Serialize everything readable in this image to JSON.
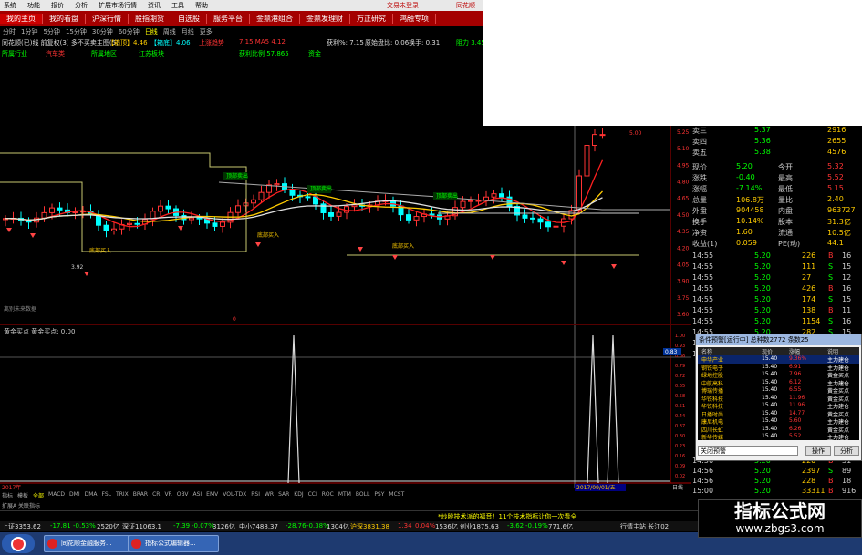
{
  "menu": {
    "items": [
      "系统",
      "功能",
      "报价",
      "分析",
      "扩展市场行情",
      "资讯",
      "工具",
      "帮助"
    ],
    "login": "交易未登录",
    "user": "同花顺"
  },
  "nav": {
    "items": [
      "我的主页",
      "我的看盘",
      "沪深行情",
      "股指期货",
      "自选股",
      "服务平台",
      "金鼎港组合",
      "金鼎发理财",
      "万正研究",
      "鸿融专项"
    ],
    "active": 0
  },
  "periods": {
    "items": [
      "分时",
      "1分钟",
      "5分钟",
      "15分钟",
      "30分钟",
      "60分钟",
      "日线",
      "周线",
      "月线",
      "更多"
    ],
    "active": 6
  },
  "info": {
    "stock": "同花顺(已)线 前复权(3) 多不买卖主图(5)",
    "ma1": "【箱顶】4.46",
    "ma2": "【箱底】4.06",
    "up": "上涨趋势",
    "ma_vals": "7.15 MA5 4.12",
    "ratio": "获利%: 7.15",
    "rate": "原始盘比: 0.06",
    "turn": "换手: 0.31",
    "power": "阻力 3.45"
  },
  "tags": {
    "t1": "所属行业",
    "t2": "汽车类",
    "t3": "所属地区",
    "t4": "江苏板块",
    "t5": "获利比例 57.865",
    "t6": "资金"
  },
  "main_chart": {
    "prices": {
      "high": "5.20",
      "low": "3.92",
      "annotation": "5.00"
    },
    "labels": {
      "buy": "底部买入",
      "sell": "顶部卖出",
      "note": "离别未来数据",
      "xlabel": "0",
      "cursor_date": "2017/09/01/五"
    },
    "yticks": [
      "5.25",
      "5.10",
      "4.95",
      "4.80",
      "4.65",
      "4.50",
      "4.35",
      "4.20",
      "4.05",
      "3.90",
      "3.75",
      "3.60"
    ]
  },
  "sub_chart": {
    "title": "黄金买点 黄金买点: 0.00",
    "yticks": [
      "1.00",
      "0.93",
      "0.86",
      "0.79",
      "0.72",
      "0.65",
      "0.58",
      "0.51",
      "0.44",
      "0.37",
      "0.30",
      "0.23",
      "0.16",
      "0.09",
      "0.02"
    ],
    "cursor_value": "0.83",
    "footer_left": "2017年",
    "footer_right": "日线"
  },
  "indicator_tabs": {
    "items": [
      "指标",
      "模板",
      "全部",
      "MACD",
      "DMI",
      "DMA",
      "FSL",
      "TRIX",
      "BRAR",
      "CR",
      "VR",
      "OBV",
      "ASI",
      "EMV",
      "VOL-TDX",
      "RSI",
      "WR",
      "SAR",
      "KDJ",
      "CCI",
      "ROC",
      "MTM",
      "BOLL",
      "PSY",
      "MCST"
    ],
    "active": 2
  },
  "sub_tabs": "扩展A 关联指标",
  "quote": {
    "top_rows": [
      [
        "卖三",
        "5.37",
        "2916"
      ],
      [
        "卖四",
        "5.36",
        "2655"
      ],
      [
        "卖五",
        "5.38",
        "4576"
      ]
    ],
    "stats": [
      [
        "现价",
        "5.20",
        "今开",
        "5.32"
      ],
      [
        "涨跌",
        "-0.40",
        "最高",
        "5.52"
      ],
      [
        "涨幅",
        "-7.14%",
        "最低",
        "5.15"
      ],
      [
        "总量",
        "106.8万",
        "量比",
        "2.40"
      ],
      [
        "外盘",
        "904458",
        "内盘",
        "963727"
      ],
      [
        "换手",
        "10.14%",
        "股本",
        "31.3亿"
      ],
      [
        "净资",
        "1.60",
        "流通",
        "10.5亿"
      ],
      [
        "收益(1)",
        "0.059",
        "PE(动)",
        "44.1"
      ]
    ],
    "ticks": [
      [
        "14:55",
        "5.20",
        "226",
        "B",
        "16"
      ],
      [
        "14:55",
        "5.20",
        "111",
        "S",
        "15"
      ],
      [
        "14:55",
        "5.20",
        "27",
        "S",
        "12"
      ],
      [
        "14:55",
        "5.20",
        "426",
        "B",
        "16"
      ],
      [
        "14:55",
        "5.20",
        "174",
        "S",
        "15"
      ],
      [
        "14:55",
        "5.20",
        "138",
        "B",
        "11"
      ],
      [
        "14:55",
        "5.20",
        "1154",
        "S",
        "16"
      ],
      [
        "14:55",
        "5.20",
        "282",
        "S",
        "15"
      ],
      [
        "14:55",
        "5.20",
        "285",
        "B",
        "9"
      ],
      [
        "14:55",
        "5.20",
        "289",
        "S",
        "8"
      ]
    ],
    "bottom_ticks": [
      [
        "14:56",
        "5.20",
        "220",
        "B",
        "31"
      ],
      [
        "14:56",
        "5.20",
        "2397",
        "S",
        "89"
      ],
      [
        "14:56",
        "5.20",
        "228",
        "B",
        "18"
      ],
      [
        "15:00",
        "5.20",
        "33311",
        "B",
        "916"
      ]
    ]
  },
  "popup": {
    "title": "条件预警[运行中] 总种数2772 条数25",
    "headers": [
      "名称",
      "现价",
      "涨幅",
      "说明"
    ],
    "rows": [
      [
        "申华产业",
        "15.40",
        "9.36%",
        "主力建仓"
      ],
      [
        "钢铁电子",
        "15.40",
        "6.91",
        "主力建仓"
      ],
      [
        "绿地控股",
        "15.40",
        "7.96",
        "黄金买点"
      ],
      [
        "中航高科",
        "15.40",
        "6.12",
        "主力建仓"
      ],
      [
        "博瑞传播",
        "15.40",
        "6.55",
        "黄金买点"
      ],
      [
        "华铁科技",
        "15.40",
        "11.96",
        "黄金买点"
      ],
      [
        "华铁科技",
        "15.40",
        "11.96",
        "主力建仓"
      ],
      [
        "日播时尚",
        "15.40",
        "14.77",
        "黄金买点"
      ],
      [
        "康尼机电",
        "15.40",
        "5.60",
        "主力建仓"
      ],
      [
        "四川长虹",
        "15.40",
        "6.26",
        "黄金买点"
      ],
      [
        "新华传媒",
        "15.40",
        "5.52",
        "主力建仓"
      ]
    ],
    "input": "关闭预警",
    "btn1": "操作",
    "btn2": "分析"
  },
  "ticker": {
    "msg": "*炒股技术派的福音！11个技术指标让你一次看全"
  },
  "status": {
    "sh": "上证3353.62",
    "sh_chg": "-17.81",
    "sh_pct": "-0.53%",
    "sh_amt": "2520亿",
    "sz": "深证11063.1",
    "sz_chg": "-7.39",
    "sz_pct": "-0.07%",
    "sz_amt": "3126亿",
    "zx": "中小7488.37",
    "zx_chg": "-28.76",
    "zx_pct": "-0.38%",
    "zx_amt": "1304亿",
    "hs": "沪深3831.38",
    "hs_chg": "1.34",
    "hs_pct": "0.04%",
    "hs_amt": "1536亿",
    "cy": "创业1875.63",
    "cy_chg": "-3.62",
    "cy_pct": "-0.19%",
    "cy_amt": "771.6亿",
    "station": "行情主站 长江02"
  },
  "taskbar": {
    "items": [
      "同花顺金融服务...",
      "指标公式编辑器..."
    ]
  },
  "watermark": {
    "line1": "指标公式网",
    "line2": "www.zbgs3.com"
  },
  "colors": {
    "up": "#ff3333",
    "down": "#00ffff",
    "ma_white": "#e0e0e0",
    "ma_yellow": "#ffcc00",
    "ma_red": "#ff2020",
    "green": "#00ff00"
  }
}
